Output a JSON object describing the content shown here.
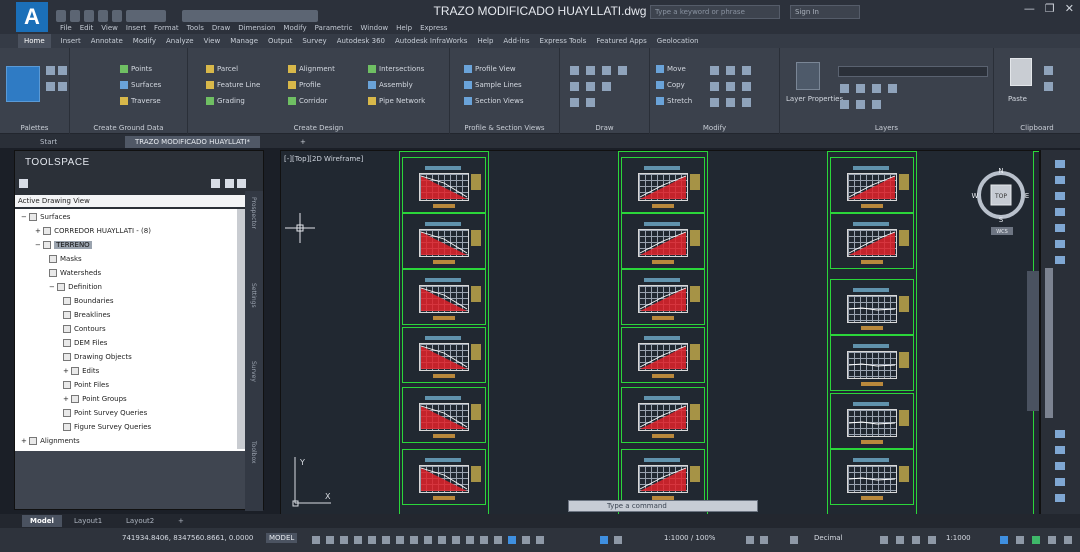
{
  "window": {
    "title": "TRAZO MODIFICADO HUAYLLATI.dwg",
    "app_logo": "A",
    "search_placeholder": "Type a keyword or phrase",
    "signin": "Sign In",
    "controls": [
      "—",
      "❐",
      "✕"
    ]
  },
  "menubar": [
    "File",
    "Edit",
    "View",
    "Insert",
    "Format",
    "Tools",
    "Draw",
    "Dimension",
    "Modify",
    "Parametric",
    "Window",
    "Help",
    "Express"
  ],
  "ribbon": {
    "tabs": [
      "Home",
      "Insert",
      "Annotate",
      "Modify",
      "Analyze",
      "View",
      "Manage",
      "Output",
      "Survey",
      "Autodesk 360",
      "Autodesk InfraWorks",
      "Help",
      "Add-ins",
      "Express Tools",
      "Featured Apps",
      "Geolocation"
    ],
    "active_tab": "Home",
    "panels": {
      "palettes": {
        "label": "Palettes",
        "big_button": "Toolspace"
      },
      "create_ground": {
        "label": "Create Ground Data",
        "items": [
          "Points",
          "Surfaces",
          "Traverse"
        ]
      },
      "create_design": {
        "label": "Create Design",
        "items": [
          "Parcel",
          "Feature Line",
          "Grading",
          "Alignment",
          "Profile",
          "Corridor",
          "Intersections",
          "Assembly",
          "Pipe Network"
        ]
      },
      "profile_section": {
        "label": "Profile & Section Views",
        "items": [
          "Profile View",
          "Sample Lines",
          "Section Views"
        ]
      },
      "draw": {
        "label": "Draw"
      },
      "modify": {
        "label": "Modify",
        "items": [
          "Move",
          "Copy",
          "Stretch"
        ]
      },
      "layers": {
        "label": "Layers",
        "big_button": "Layer Properties"
      },
      "clipboard": {
        "label": "Clipboard",
        "big_button": "Paste"
      }
    }
  },
  "doc_tabs": [
    "Start",
    "TRAZO MODIFICADO HUAYLLATI*"
  ],
  "toolspace": {
    "title": "TOOLSPACE",
    "view_select": "Active Drawing View",
    "side_tabs": [
      "Prospector",
      "Settings",
      "Survey",
      "Toolbox"
    ],
    "tree": [
      {
        "label": "Surfaces",
        "indent": 1,
        "expander": "−"
      },
      {
        "label": "CORREDOR HUAYLLATI - (8)",
        "indent": 2,
        "expander": "+"
      },
      {
        "label": "TERRENO",
        "indent": 2,
        "expander": "−",
        "selected": true
      },
      {
        "label": "Masks",
        "indent": 3,
        "expander": ""
      },
      {
        "label": "Watersheds",
        "indent": 3,
        "expander": ""
      },
      {
        "label": "Definition",
        "indent": 3,
        "expander": "−"
      },
      {
        "label": "Boundaries",
        "indent": 4,
        "expander": ""
      },
      {
        "label": "Breaklines",
        "indent": 4,
        "expander": ""
      },
      {
        "label": "Contours",
        "indent": 4,
        "expander": ""
      },
      {
        "label": "DEM Files",
        "indent": 4,
        "expander": ""
      },
      {
        "label": "Drawing Objects",
        "indent": 4,
        "expander": ""
      },
      {
        "label": "Edits",
        "indent": 4,
        "expander": "+"
      },
      {
        "label": "Point Files",
        "indent": 4,
        "expander": ""
      },
      {
        "label": "Point Groups",
        "indent": 4,
        "expander": "+"
      },
      {
        "label": "Point Survey Queries",
        "indent": 4,
        "expander": ""
      },
      {
        "label": "Figure Survey Queries",
        "indent": 4,
        "expander": ""
      },
      {
        "label": "Alignments",
        "indent": 1,
        "expander": "+"
      }
    ]
  },
  "viewport": {
    "view_label": "[-][Top][2D Wireframe]",
    "viewcube": {
      "face": "TOP",
      "n": "N",
      "s": "S",
      "e": "E",
      "w": "W",
      "wcs": "WCS"
    },
    "ucs": {
      "x": "X",
      "y": "Y"
    },
    "command_placeholder": "Type a command"
  },
  "layout_tabs": [
    "Model",
    "Layout1",
    "Layout2",
    "+"
  ],
  "status": {
    "coordinates": "741934.8406, 8347560.8661, 0.0000",
    "model": "MODEL",
    "scale": "1:1000 / 100%",
    "units": "Decimal",
    "annoscale": "1:1000"
  },
  "colors": {
    "accent_blue": "#2f7bc4",
    "frame_green": "#2bd63a",
    "profile_red": "#e0222a",
    "viewport_bg": "#212831"
  }
}
